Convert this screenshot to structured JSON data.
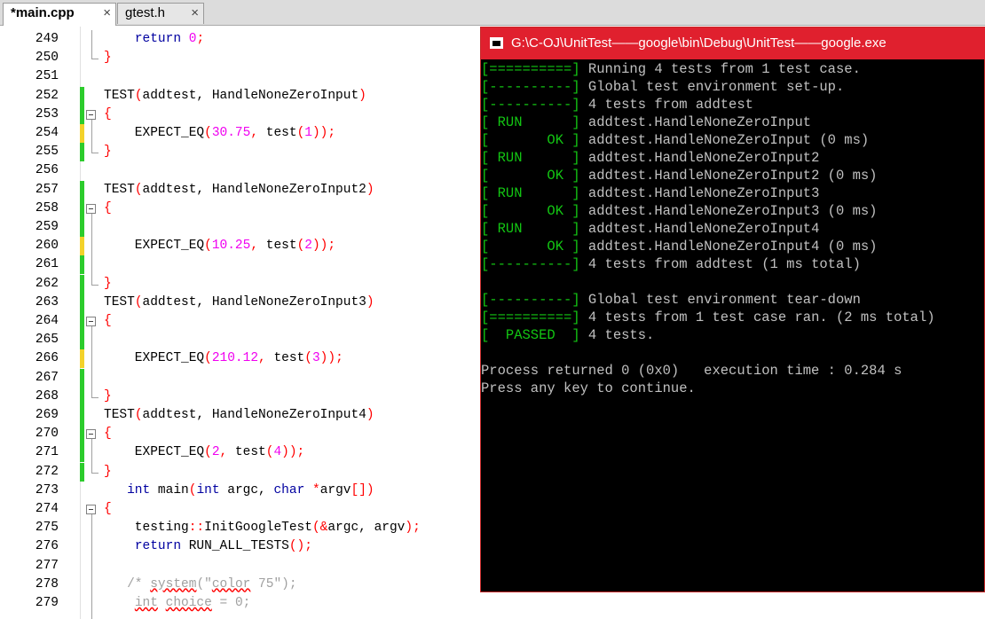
{
  "tabs": [
    {
      "label": "*main.cpp",
      "close": "×"
    },
    {
      "label": "gtest.h",
      "close": "×"
    }
  ],
  "editor": {
    "lines": [
      {
        "n": "249",
        "code": [
          "    ",
          [
            "kw",
            "return"
          ],
          " ",
          [
            "num",
            "0"
          ],
          [
            "red",
            ";"
          ]
        ]
      },
      {
        "n": "250",
        "code": [
          [
            "red",
            "}"
          ]
        ]
      },
      {
        "n": "251",
        "code": []
      },
      {
        "n": "252",
        "code": [
          "TEST",
          [
            "red",
            "("
          ],
          "addtest, HandleNoneZeroInput",
          [
            "red",
            ")"
          ]
        ]
      },
      {
        "n": "253",
        "code": [
          [
            "red",
            "{"
          ]
        ]
      },
      {
        "n": "254",
        "code": [
          "    EXPECT_EQ",
          [
            "red",
            "("
          ],
          [
            "num",
            "30.75"
          ],
          [
            "red",
            ","
          ],
          " test",
          [
            "red",
            "("
          ],
          [
            "num",
            "1"
          ],
          [
            "red",
            "));"
          ]
        ]
      },
      {
        "n": "255",
        "code": [
          [
            "red",
            "}"
          ]
        ]
      },
      {
        "n": "256",
        "code": []
      },
      {
        "n": "257",
        "code": [
          "TEST",
          [
            "red",
            "("
          ],
          "addtest, HandleNoneZeroInput2",
          [
            "red",
            ")"
          ]
        ]
      },
      {
        "n": "258",
        "code": [
          [
            "red",
            "{"
          ]
        ]
      },
      {
        "n": "259",
        "code": []
      },
      {
        "n": "260",
        "code": [
          "    EXPECT_EQ",
          [
            "red",
            "("
          ],
          [
            "num",
            "10.25"
          ],
          [
            "red",
            ","
          ],
          " test",
          [
            "red",
            "("
          ],
          [
            "num",
            "2"
          ],
          [
            "red",
            "));"
          ]
        ]
      },
      {
        "n": "261",
        "code": []
      },
      {
        "n": "262",
        "code": [
          [
            "red",
            "}"
          ]
        ]
      },
      {
        "n": "263",
        "code": [
          "TEST",
          [
            "red",
            "("
          ],
          "addtest, HandleNoneZeroInput3",
          [
            "red",
            ")"
          ]
        ]
      },
      {
        "n": "264",
        "code": [
          [
            "red",
            "{"
          ]
        ]
      },
      {
        "n": "265",
        "code": []
      },
      {
        "n": "266",
        "code": [
          "    EXPECT_EQ",
          [
            "red",
            "("
          ],
          [
            "num",
            "210.12"
          ],
          [
            "red",
            ","
          ],
          " test",
          [
            "red",
            "("
          ],
          [
            "num",
            "3"
          ],
          [
            "red",
            "));"
          ]
        ]
      },
      {
        "n": "267",
        "code": []
      },
      {
        "n": "268",
        "code": [
          [
            "red",
            "}"
          ]
        ]
      },
      {
        "n": "269",
        "code": [
          "TEST",
          [
            "red",
            "("
          ],
          "addtest, HandleNoneZeroInput4",
          [
            "red",
            ")"
          ]
        ]
      },
      {
        "n": "270",
        "code": [
          [
            "red",
            "{"
          ]
        ]
      },
      {
        "n": "271",
        "code": [
          "    EXPECT_EQ",
          [
            "red",
            "("
          ],
          [
            "num",
            "2"
          ],
          [
            "red",
            ","
          ],
          " test",
          [
            "red",
            "("
          ],
          [
            "num",
            "4"
          ],
          [
            "red",
            "));"
          ]
        ]
      },
      {
        "n": "272",
        "code": [
          [
            "red",
            "}"
          ]
        ]
      },
      {
        "n": "273",
        "code": [
          "   ",
          [
            "kw",
            "int"
          ],
          " main",
          [
            "red",
            "("
          ],
          [
            "kw",
            "int"
          ],
          " argc, ",
          [
            "kw",
            "char"
          ],
          " ",
          [
            "red",
            "*"
          ],
          "argv",
          [
            "red",
            "[])"
          ]
        ]
      },
      {
        "n": "274",
        "code": [
          [
            "red",
            "{"
          ]
        ]
      },
      {
        "n": "275",
        "code": [
          "    testing",
          [
            "red",
            "::"
          ],
          "InitGoogleTest",
          [
            "red",
            "(&"
          ],
          "argc, argv",
          [
            "red",
            ");"
          ]
        ]
      },
      {
        "n": "276",
        "code": [
          "    ",
          [
            "kw",
            "return"
          ],
          " RUN_ALL_TESTS",
          [
            "red",
            "();"
          ]
        ]
      },
      {
        "n": "277",
        "code": []
      },
      {
        "n": "278",
        "code": [
          "   ",
          [
            "cmt",
            "/* "
          ],
          [
            "cmtsq",
            "system"
          ],
          [
            "cmt",
            "(\""
          ],
          [
            "cmtsq",
            "color"
          ],
          [
            "cmt",
            " 75\");"
          ]
        ]
      },
      {
        "n": "279",
        "code": [
          "    ",
          [
            "cmtsq",
            "int"
          ],
          [
            "cmt",
            " "
          ],
          [
            "cmtsq",
            "choice"
          ],
          [
            "cmt",
            " = 0;"
          ]
        ]
      }
    ]
  },
  "console": {
    "title": "G:\\C-OJ\\UnitTest——google\\bin\\Debug\\UnitTest——google.exe",
    "lines": [
      {
        "tag": "[==========]",
        "text": " Running 4 tests from 1 test case."
      },
      {
        "tag": "[----------]",
        "text": " Global test environment set-up."
      },
      {
        "tag": "[----------]",
        "text": " 4 tests from addtest"
      },
      {
        "tag": "[ RUN      ]",
        "text": " addtest.HandleNoneZeroInput"
      },
      {
        "tag": "[       OK ]",
        "text": " addtest.HandleNoneZeroInput (0 ms)"
      },
      {
        "tag": "[ RUN      ]",
        "text": " addtest.HandleNoneZeroInput2"
      },
      {
        "tag": "[       OK ]",
        "text": " addtest.HandleNoneZeroInput2 (0 ms)"
      },
      {
        "tag": "[ RUN      ]",
        "text": " addtest.HandleNoneZeroInput3"
      },
      {
        "tag": "[       OK ]",
        "text": " addtest.HandleNoneZeroInput3 (0 ms)"
      },
      {
        "tag": "[ RUN      ]",
        "text": " addtest.HandleNoneZeroInput4"
      },
      {
        "tag": "[       OK ]",
        "text": " addtest.HandleNoneZeroInput4 (0 ms)"
      },
      {
        "tag": "[----------]",
        "text": " 4 tests from addtest (1 ms total)"
      },
      {
        "tag": "",
        "text": ""
      },
      {
        "tag": "[----------]",
        "text": " Global test environment tear-down"
      },
      {
        "tag": "[==========]",
        "text": " 4 tests from 1 test case ran. (2 ms total)"
      },
      {
        "tag": "[  PASSED  ]",
        "text": " 4 tests."
      },
      {
        "tag": "",
        "text": ""
      },
      {
        "tag": "",
        "text": "Process returned 0 (0x0)   execution time : 0.284 s"
      },
      {
        "tag": "",
        "text": "Press any key to continue."
      }
    ]
  },
  "colors": {
    "change_saved": "#2ccc2c",
    "change_unsaved": "#f3d22a",
    "console_title_bg": "#e0202e",
    "console_tag": "#13c613"
  }
}
